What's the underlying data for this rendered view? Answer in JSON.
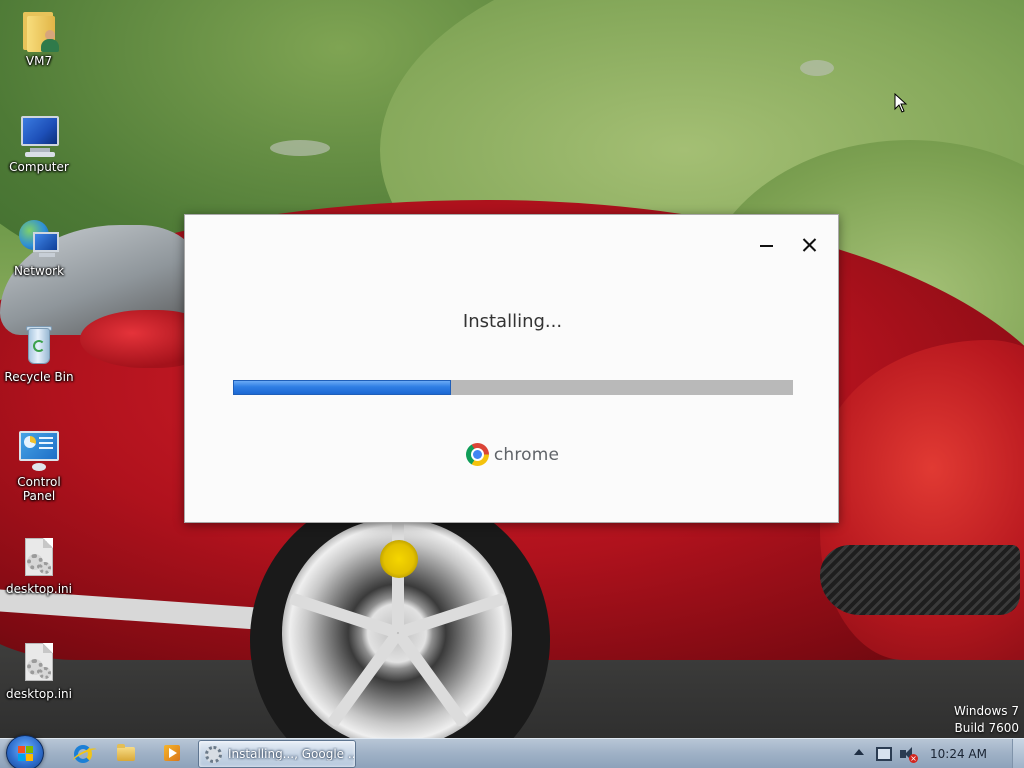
{
  "desktop": {
    "icons": [
      {
        "label": "VM7",
        "icon": "user-folder-icon"
      },
      {
        "label": "Computer",
        "icon": "computer-icon"
      },
      {
        "label": "Network",
        "icon": "network-icon"
      },
      {
        "label": "Recycle Bin",
        "icon": "recycle-bin-icon"
      },
      {
        "label": "Control Panel",
        "icon": "control-panel-icon"
      },
      {
        "label": "desktop.ini",
        "icon": "ini-file-icon"
      },
      {
        "label": "desktop.ini",
        "icon": "ini-file-icon"
      }
    ],
    "watermark": {
      "line1": "Windows 7",
      "line2": "Build 7600"
    }
  },
  "dialog": {
    "status": "Installing...",
    "progress": 0.39,
    "brand": "chrome",
    "minimize_icon": "minimize-icon",
    "close_icon": "close-icon",
    "colors": {
      "progress_fill": "#2f7ee4",
      "progress_track": "#b9b9b9"
    }
  },
  "taskbar": {
    "pinned": [
      {
        "name": "internet-explorer",
        "icon": "internet-explorer-icon"
      },
      {
        "name": "windows-explorer",
        "icon": "folder-icon"
      },
      {
        "name": "media-player",
        "icon": "media-player-icon"
      }
    ],
    "active_task": "Installing..., Google ...",
    "clock": "10:24 AM",
    "tray_icons": [
      "show-hidden-icons-icon",
      "network-icon",
      "volume-muted-icon"
    ]
  }
}
